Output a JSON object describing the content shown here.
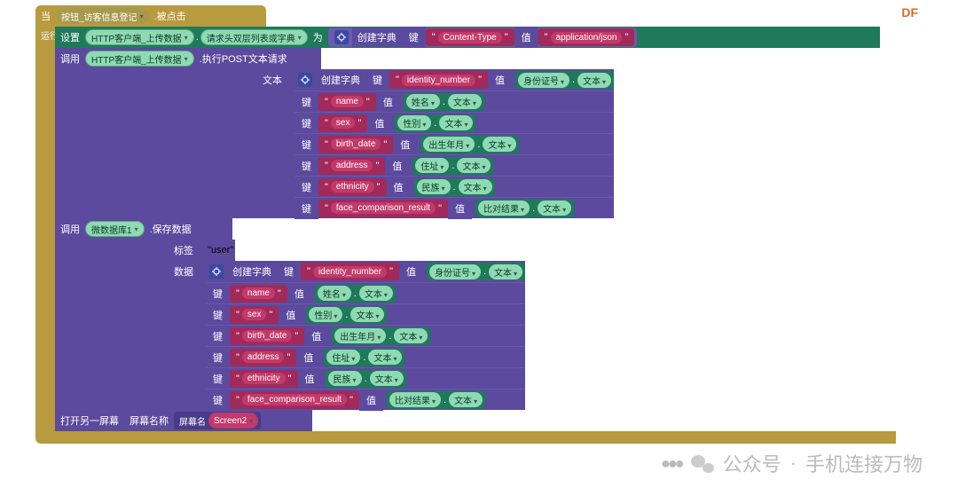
{
  "logo": "DF",
  "watermark": {
    "account_label": "公众号",
    "account_name": "手机连接万物"
  },
  "event": {
    "when": "当",
    "component": "按钮_访客信息登记",
    "trigger": ".被点击",
    "footer": "运行"
  },
  "set_headers": {
    "set": "设置",
    "component": "HTTP客户端_上传数据",
    "prop": "请求头双层列表或字典",
    "to": "为",
    "create_dict": "创建字典",
    "key": "键",
    "key_val": "Content-Type",
    "val": "值",
    "val_val": "application/json"
  },
  "http_post": {
    "call": "调用",
    "component": "HTTP客户端_上传数据",
    "method": ".执行POST文本请求",
    "text_label": "文本",
    "create_dict": "创建字典",
    "kv": [
      {
        "k": "identity_number",
        "src": "身份证号",
        "field": "文本"
      },
      {
        "k": "name",
        "src": "姓名",
        "field": "文本"
      },
      {
        "k": "sex",
        "src": "性别",
        "field": "文本"
      },
      {
        "k": "birth_date",
        "src": "出生年月",
        "field": "文本"
      },
      {
        "k": "address",
        "src": "住址",
        "field": "文本"
      },
      {
        "k": "ethnicity",
        "src": "民族",
        "field": "文本"
      },
      {
        "k": "face_comparison_result",
        "src": "比对结果",
        "field": "文本"
      }
    ]
  },
  "db_save": {
    "call": "调用",
    "component": "微数据库1",
    "method": ".保存数据",
    "tag_label": "标签",
    "tag_value": "user",
    "data_label": "数据",
    "create_dict": "创建字典",
    "kv": [
      {
        "k": "identity_number",
        "src": "身份证号",
        "field": "文本"
      },
      {
        "k": "name",
        "src": "姓名",
        "field": "文本"
      },
      {
        "k": "sex",
        "src": "性别",
        "field": "文本"
      },
      {
        "k": "birth_date",
        "src": "出生年月",
        "field": "文本"
      },
      {
        "k": "address",
        "src": "住址",
        "field": "文本"
      },
      {
        "k": "ethnicity",
        "src": "民族",
        "field": "文本"
      },
      {
        "k": "face_comparison_result",
        "src": "比对结果",
        "field": "文本"
      }
    ]
  },
  "open_screen": {
    "label": "打开另一屏幕",
    "param": "屏幕名称",
    "param2": "屏幕名",
    "value": "Screen2"
  },
  "labels": {
    "key": "键",
    "val": "值"
  }
}
